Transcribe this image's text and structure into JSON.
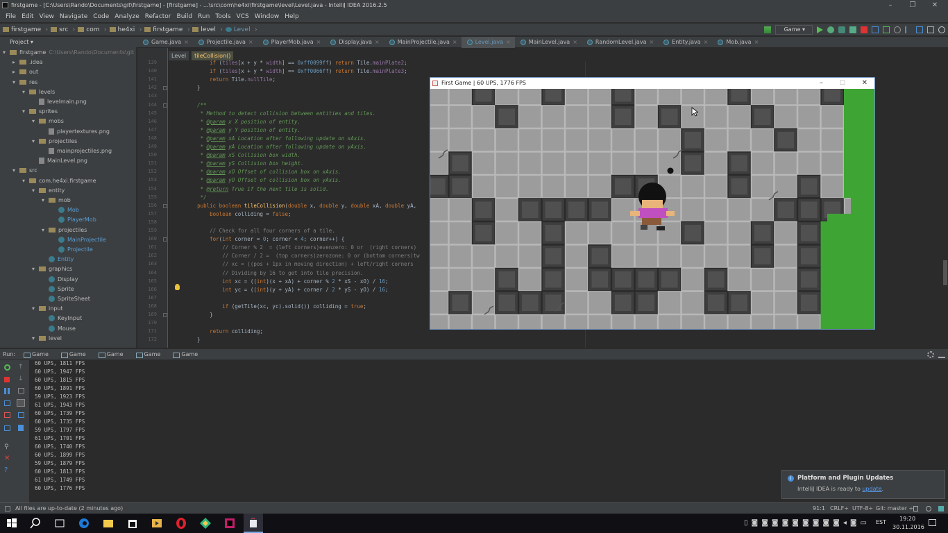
{
  "window": {
    "title": "firstgame - [C:\\Users\\Rando\\Documents\\git\\firstgame] - [firstgame] - ...\\src\\com\\he4xi\\firstgame\\level\\Level.java - IntelliJ IDEA 2016.2.5"
  },
  "menu": [
    "File",
    "Edit",
    "View",
    "Navigate",
    "Code",
    "Analyze",
    "Refactor",
    "Build",
    "Run",
    "Tools",
    "VCS",
    "Window",
    "Help"
  ],
  "breadcrumbs": [
    "firstgame",
    "src",
    "com",
    "he4xi",
    "firstgame",
    "level",
    "Level"
  ],
  "run_config": "Game",
  "project_header": "Project",
  "tabs": [
    {
      "label": "Game.java",
      "active": false
    },
    {
      "label": "Projectile.java",
      "active": false
    },
    {
      "label": "PlayerMob.java",
      "active": false
    },
    {
      "label": "Display.java",
      "active": false
    },
    {
      "label": "MainProjectile.java",
      "active": false
    },
    {
      "label": "Level.java",
      "active": true
    },
    {
      "label": "MainLevel.java",
      "active": false
    },
    {
      "label": "RandomLevel.java",
      "active": false
    },
    {
      "label": "Entity.java",
      "active": false
    },
    {
      "label": "Mob.java",
      "active": false
    }
  ],
  "tree": [
    {
      "label": "firstgame",
      "path": "C:\\Users\\Rando\\Documents\\git",
      "d": 0,
      "t": "folder",
      "open": true
    },
    {
      "label": ".idea",
      "d": 1,
      "t": "folder",
      "open": false
    },
    {
      "label": "out",
      "d": 1,
      "t": "folder",
      "open": false
    },
    {
      "label": "res",
      "d": 1,
      "t": "folder",
      "open": true
    },
    {
      "label": "levels",
      "d": 2,
      "t": "folder",
      "open": true
    },
    {
      "label": "levelmain.png",
      "d": 3,
      "t": "png"
    },
    {
      "label": "sprites",
      "d": 2,
      "t": "folder",
      "open": true
    },
    {
      "label": "mobs",
      "d": 3,
      "t": "folder",
      "open": true
    },
    {
      "label": "playertextures.png",
      "d": 4,
      "t": "png"
    },
    {
      "label": "projectiles",
      "d": 3,
      "t": "folder",
      "open": true
    },
    {
      "label": "mainprojectiles.png",
      "d": 4,
      "t": "png"
    },
    {
      "label": "MainLevel.png",
      "d": 3,
      "t": "png"
    },
    {
      "label": "src",
      "d": 1,
      "t": "folder",
      "open": true
    },
    {
      "label": "com.he4xi.firstgame",
      "d": 2,
      "t": "folder",
      "open": true
    },
    {
      "label": "entity",
      "d": 3,
      "t": "folder",
      "open": true
    },
    {
      "label": "mob",
      "d": 4,
      "t": "folder",
      "open": true
    },
    {
      "label": "Mob",
      "d": 5,
      "t": "java",
      "blue": true
    },
    {
      "label": "PlayerMob",
      "d": 5,
      "t": "java",
      "blue": true
    },
    {
      "label": "projectiles",
      "d": 4,
      "t": "folder",
      "open": true
    },
    {
      "label": "MainProjectile",
      "d": 5,
      "t": "java",
      "blue": true
    },
    {
      "label": "Projectile",
      "d": 5,
      "t": "java",
      "blue": true
    },
    {
      "label": "Entity",
      "d": 4,
      "t": "java",
      "blue": true
    },
    {
      "label": "graphics",
      "d": 3,
      "t": "folder",
      "open": true
    },
    {
      "label": "Display",
      "d": 4,
      "t": "java"
    },
    {
      "label": "Sprite",
      "d": 4,
      "t": "java"
    },
    {
      "label": "SpriteSheet",
      "d": 4,
      "t": "java"
    },
    {
      "label": "input",
      "d": 3,
      "t": "folder",
      "open": true
    },
    {
      "label": "KeyInput",
      "d": 4,
      "t": "java"
    },
    {
      "label": "Mouse",
      "d": 4,
      "t": "java"
    },
    {
      "label": "level",
      "d": 3,
      "t": "folder",
      "open": true
    }
  ],
  "editor_crumbs": [
    "Level",
    "tileCollision()"
  ],
  "code": [
    {
      "n": "139",
      "html": "        <span class='kw'>if</span> (<span class='fld'>tiles</span>[x + y * <span class='fld'>width</span>] == <span class='num'>0xff0099ff</span>) <span class='kw'>return</span> Tile.<span class='fld'>mainPlate2</span>;"
    },
    {
      "n": "140",
      "html": "        <span class='kw'>if</span> (<span class='fld'>tiles</span>[x + y * <span class='fld'>width</span>] == <span class='num'>0xff0066ff</span>) <span class='kw'>return</span> Tile.<span class='fld'>mainPlate3</span>;"
    },
    {
      "n": "141",
      "html": "        <span class='kw'>return</span> Tile.<span class='fld'>nullTile</span>;"
    },
    {
      "n": "142",
      "html": "    }"
    },
    {
      "n": "143",
      "html": ""
    },
    {
      "n": "144",
      "html": "    <span class='cmt'>/**</span>"
    },
    {
      "n": "145",
      "html": "<span class='cmt'>     * Method to detect collision between entities and tiles.</span>"
    },
    {
      "n": "146",
      "html": "<span class='cmt'>     * <u>@param</u> x X position of entity.</span>"
    },
    {
      "n": "147",
      "html": "<span class='cmt'>     * <u>@param</u> y Y position of entity.</span>"
    },
    {
      "n": "148",
      "html": "<span class='cmt'>     * <u>@param</u> xA Location after following update on xAxis.</span>"
    },
    {
      "n": "149",
      "html": "<span class='cmt'>     * <u>@param</u> yA Location after following update on yAxis.</span>"
    },
    {
      "n": "150",
      "html": "<span class='cmt'>     * <u>@param</u> xS Collision box width.</span>"
    },
    {
      "n": "151",
      "html": "<span class='cmt'>     * <u>@param</u> yS Collision box height.</span>"
    },
    {
      "n": "152",
      "html": "<span class='cmt'>     * <u>@param</u> xO Offset of collision box on xAxis.</span>"
    },
    {
      "n": "153",
      "html": "<span class='cmt'>     * <u>@param</u> yO Offset of collision box on yAxis.</span>"
    },
    {
      "n": "154",
      "html": "<span class='cmt'>     * <u>@return</u> True if the next tile is solid.</span>"
    },
    {
      "n": "155",
      "html": "<span class='cmt'>     */</span>"
    },
    {
      "n": "156",
      "html": "    <span class='kw'>public boolean</span> <span class='fn'>tileCollision</span>(<span class='kw'>double</span> x, <span class='kw'>double</span> y, <span class='kw'>double</span> xA, <span class='kw'>double</span> yA,"
    },
    {
      "n": "157",
      "html": "        <span class='kw'>boolean</span> colliding = <span class='kw'>false</span>;"
    },
    {
      "n": "158",
      "html": ""
    },
    {
      "n": "159",
      "html": "        <span class='gcmt'>// Check for all four corners of a tile.</span>"
    },
    {
      "n": "160",
      "html": "        <span class='kw'>for</span>(<span class='kw'>int</span> corner = <span class='num'>0</span>; corner &lt; <span class='num'>4</span>; corner++) {"
    },
    {
      "n": "161",
      "html": "            <span class='gcmt'>// Corner % 2  = (left corners)evenzero: 0 or  (right corners)</span>"
    },
    {
      "n": "162",
      "html": "            <span class='gcmt'>// Corner / 2 =  (top corners)zerozone: 0 or (bottom corners)tw</span>"
    },
    {
      "n": "163",
      "html": "            <span class='gcmt'>// xc = ((pos + 1px in moving direction) + left/right corners</span>"
    },
    {
      "n": "164",
      "html": "            <span class='gcmt'>// Dividing by 16 to get into tile precision.</span>"
    },
    {
      "n": "165",
      "html": "            <span class='kw'>int</span> xc = ((<span class='kw'>int</span>)(x + xA) + corner % <span class='num'>2</span> * xS - xO) / <span class='num'>16</span>;"
    },
    {
      "n": "166",
      "html": "            <span class='kw'>int</span> yc = ((<span class='kw'>int</span>)(y + yA) + corner / <span class='num'>2</span> * yS - yO) / <span class='num'>16</span>;"
    },
    {
      "n": "167",
      "html": ""
    },
    {
      "n": "168",
      "html": "            <span class='kw'>if</span> (getTile(xc, yc).solid()) colliding = <span class='kw'>true</span>;"
    },
    {
      "n": "169",
      "html": "        }"
    },
    {
      "n": "170",
      "html": ""
    },
    {
      "n": "171",
      "html": "        <span class='kw'>return</span> colliding;"
    },
    {
      "n": "172",
      "html": "    }"
    }
  ],
  "run": {
    "label": "Run:",
    "tabs": [
      "Game",
      "Game",
      "Game",
      "Game",
      "Game"
    ]
  },
  "console_lines": [
    "60 UPS, 1811 FPS",
    "60 UPS, 1947 FPS",
    "60 UPS, 1815 FPS",
    "60 UPS, 1891 FPS",
    "59 UPS, 1923 FPS",
    "61 UPS, 1943 FPS",
    "60 UPS, 1739 FPS",
    "60 UPS, 1735 FPS",
    "59 UPS, 1797 FPS",
    "61 UPS, 1701 FPS",
    "60 UPS, 1740 FPS",
    "60 UPS, 1899 FPS",
    "59 UPS, 1879 FPS",
    "60 UPS, 1813 FPS",
    "61 UPS, 1749 FPS",
    "60 UPS, 1776 FPS"
  ],
  "status": {
    "message": "All files are up-to-date (2 minutes ago)",
    "position": "91:1",
    "line_sep": "CRLF÷",
    "encoding": "UTF-8÷",
    "git": "Git: master ÷"
  },
  "notification": {
    "title": "Platform and Plugin Updates",
    "body_prefix": "IntelliJ IDEA is ready to ",
    "link": "update",
    "body_suffix": "."
  },
  "game": {
    "title": "First Game | 60 UPS, 1776 FPS"
  },
  "taskbar": {
    "lang": "EST",
    "time": "19:20",
    "date": "30.11.2016"
  }
}
